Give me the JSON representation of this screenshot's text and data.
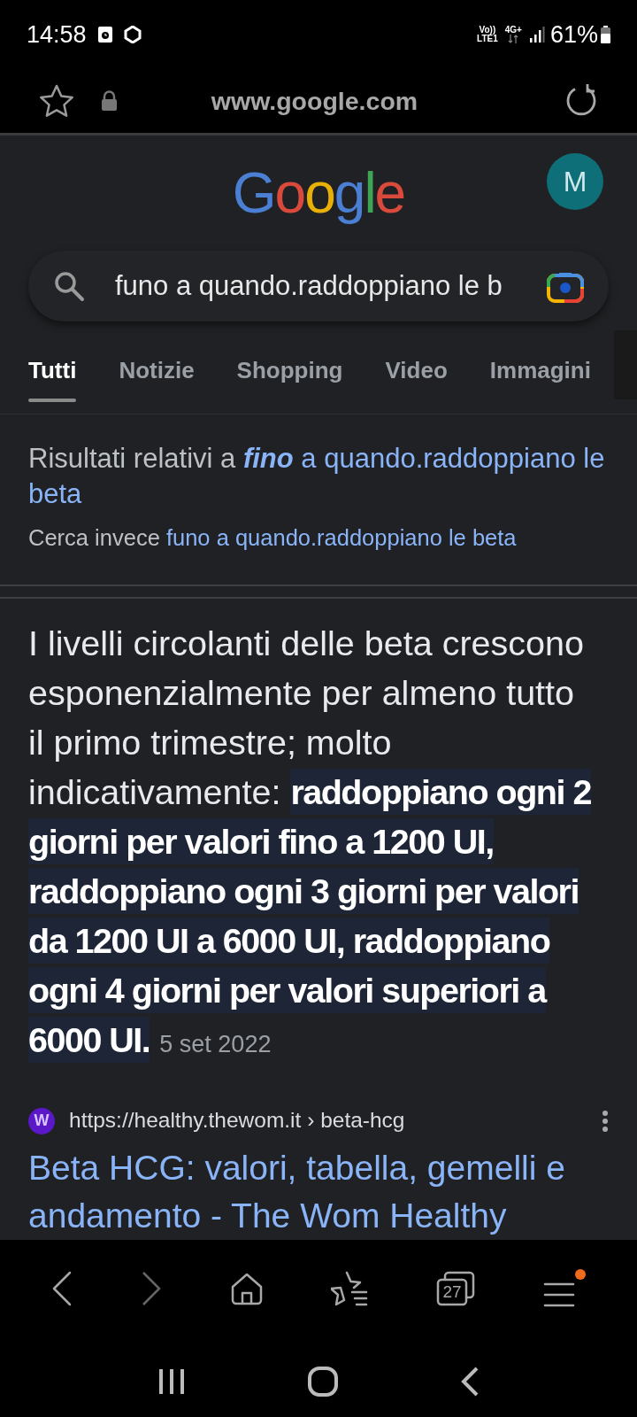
{
  "status_bar": {
    "time": "14:58",
    "volte": "Vo))",
    "lte": "LTE1",
    "network": "4G+",
    "battery": "61%"
  },
  "address_bar": {
    "url": "www.google.com",
    "bookmarked": false
  },
  "header": {
    "logo": "Google",
    "avatar": "M"
  },
  "search": {
    "value": "funo a quando.raddoppiano le b"
  },
  "tabs": [
    {
      "label": "Tutti",
      "selected": true
    },
    {
      "label": "Notizie",
      "selected": false
    },
    {
      "label": "Shopping",
      "selected": false
    },
    {
      "label": "Video",
      "selected": false
    },
    {
      "label": "Immagini",
      "selected": false
    }
  ],
  "correction": {
    "prefix": "Risultati relativi a ",
    "corrected_word": "fino",
    "corrected_rest": " a quando.raddoppiano le beta",
    "instead_label": "Cerca invece",
    "instead_link": "funo a quando.raddoppiano le beta"
  },
  "snippet": {
    "text": "I livelli circolanti delle beta crescono esponenzialmente per almeno tutto il primo trimestre; molto indicativamente: ",
    "highlight": "raddoppiano ogni 2 giorni per valori fino a 1200 UI, raddoppiano ogni 3 giorni per valori da 1200 UI a 6000 UI, raddoppiano ogni 4 giorni per valori superiori a 6000 UI.",
    "date": "5 set 2022"
  },
  "result": {
    "favicon": "W",
    "source": "https://healthy.thewom.it › beta-hcg",
    "title": "Beta HCG: valori, tabella, gemelli e andamento - The Wom Healthy"
  },
  "toolbar": {
    "tab_count": "27",
    "menu_badge": true
  }
}
